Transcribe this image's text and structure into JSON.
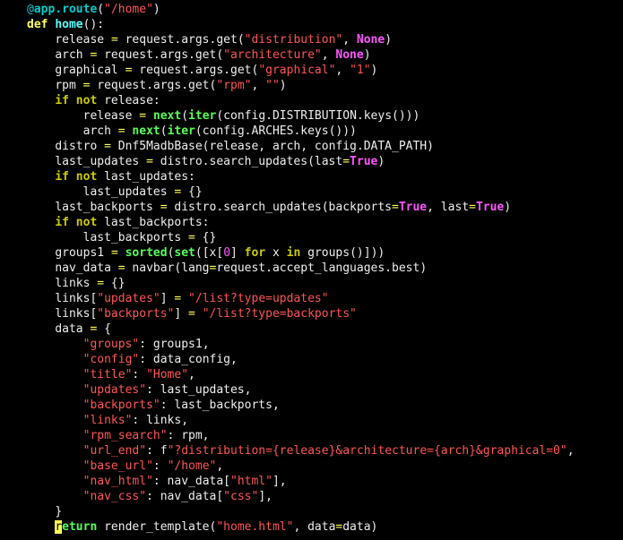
{
  "code": {
    "decorator_at": "@",
    "decorator_path": "app.route",
    "decorator_open": "(",
    "decorator_arg": "\"/home\"",
    "decorator_close": ")",
    "def_kw": "def",
    "fn_name": "home",
    "fn_sig": "():",
    "l03a": "release ",
    "eq": "=",
    "l03b": " request.args.get(",
    "s_distribution": "\"distribution\"",
    "comma_sp": ", ",
    "kw_None": "None",
    "close_paren": ")",
    "l04a": "arch ",
    "l04b": " request.args.get(",
    "s_architecture": "\"architecture\"",
    "l05a": "graphical ",
    "l05b": " request.args.get(",
    "s_graphical": "\"graphical\"",
    "s_one": "\"1\"",
    "l06a": "rpm ",
    "l06b": " request.args.get(",
    "s_rpm": "\"rpm\"",
    "s_empty": "\"\"",
    "kw_if": "if",
    "kw_not": "not",
    "l07b": " release:",
    "l08a": "release ",
    "fn_next": "next",
    "open_paren": "(",
    "fn_iter": "iter",
    "l08b": "(config.DISTRIBUTION.keys()))",
    "l09a": "arch ",
    "l09b": "(config.ARCHES.keys()))",
    "l10a": "distro ",
    "l10b": " Dnf5MadbBase(release, arch, config.DATA_PATH)",
    "l11a": "last_updates ",
    "l11b": " distro.search_updates(last",
    "kw_True": "True",
    "l12b": " last_updates:",
    "l13a": "last_updates ",
    "l13b": " {}",
    "l14a": "last_backports ",
    "l14b": " distro.search_updates(backports",
    "l14c": ", last",
    "l15b": " last_backports:",
    "l16a": "last_backports ",
    "l17a": "groups1 ",
    "fn_sorted": "sorted",
    "fn_set": "set",
    "l17b": "([x[",
    "num0": "0",
    "l17c": "] ",
    "kw_for": "for",
    "l17d": " x ",
    "kw_in": "in",
    "l17e": " groups()]))",
    "l18a": "nav_data ",
    "l18b": " navbar(lang",
    "l18c": "request.accept_languages.best)",
    "l19a": "links ",
    "l20a": "links[",
    "s_updates": "\"updates\"",
    "l20b": "] ",
    "s_list_updates": "\"/list?type=updates\"",
    "s_backports": "\"backports\"",
    "s_list_backports": "\"/list?type=backports\"",
    "l22a": "data ",
    "l22b": " {",
    "s_groups": "\"groups\"",
    "v_groups": ": groups1,",
    "s_config": "\"config\"",
    "v_config": ": data_config,",
    "s_title": "\"title\"",
    "colon_sp": ": ",
    "s_Home": "\"Home\"",
    "trailing_comma": ",",
    "v_updates": ": last_updates,",
    "v_backports": ": last_backports,",
    "s_links": "\"links\"",
    "v_links": ": links,",
    "s_rpm_search": "\"rpm_search\"",
    "v_rpm": ": rpm,",
    "s_url_end": "\"url_end\"",
    "v_url_end_pre": ": f",
    "s_url_end_val": "\"?distribution={release}&architecture={arch}&graphical=0\"",
    "s_base_url": "\"base_url\"",
    "s_base_url_val": "\"/home\"",
    "s_nav_html": "\"nav_html\"",
    "v_nav_html_a": ": nav_data[",
    "s_html": "\"html\"",
    "v_nav_html_b": "],",
    "s_nav_css": "\"nav_css\"",
    "s_css": "\"css\"",
    "close_brace": "}",
    "kw_return_r": "r",
    "kw_return_tail": "eturn",
    "ret_call_a": " render_template(",
    "s_home_html": "\"home.html\"",
    "ret_call_b": ", data",
    "ret_call_c": "data)"
  }
}
